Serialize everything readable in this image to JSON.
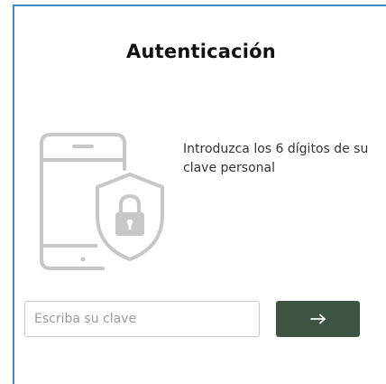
{
  "dialog": {
    "title": "Autenticación",
    "instruction": "Introduzca los 6 dígitos de su clave personal"
  },
  "form": {
    "key_input": {
      "value": "",
      "placeholder": "Escriba su clave"
    },
    "submit": {
      "icon": "arrow-right-icon",
      "color": "#3e5443"
    }
  },
  "illustration": {
    "icon": "phone-shield-lock-icon",
    "color": "#c7c7c7"
  },
  "frame": {
    "border_color": "#4a86c5"
  }
}
